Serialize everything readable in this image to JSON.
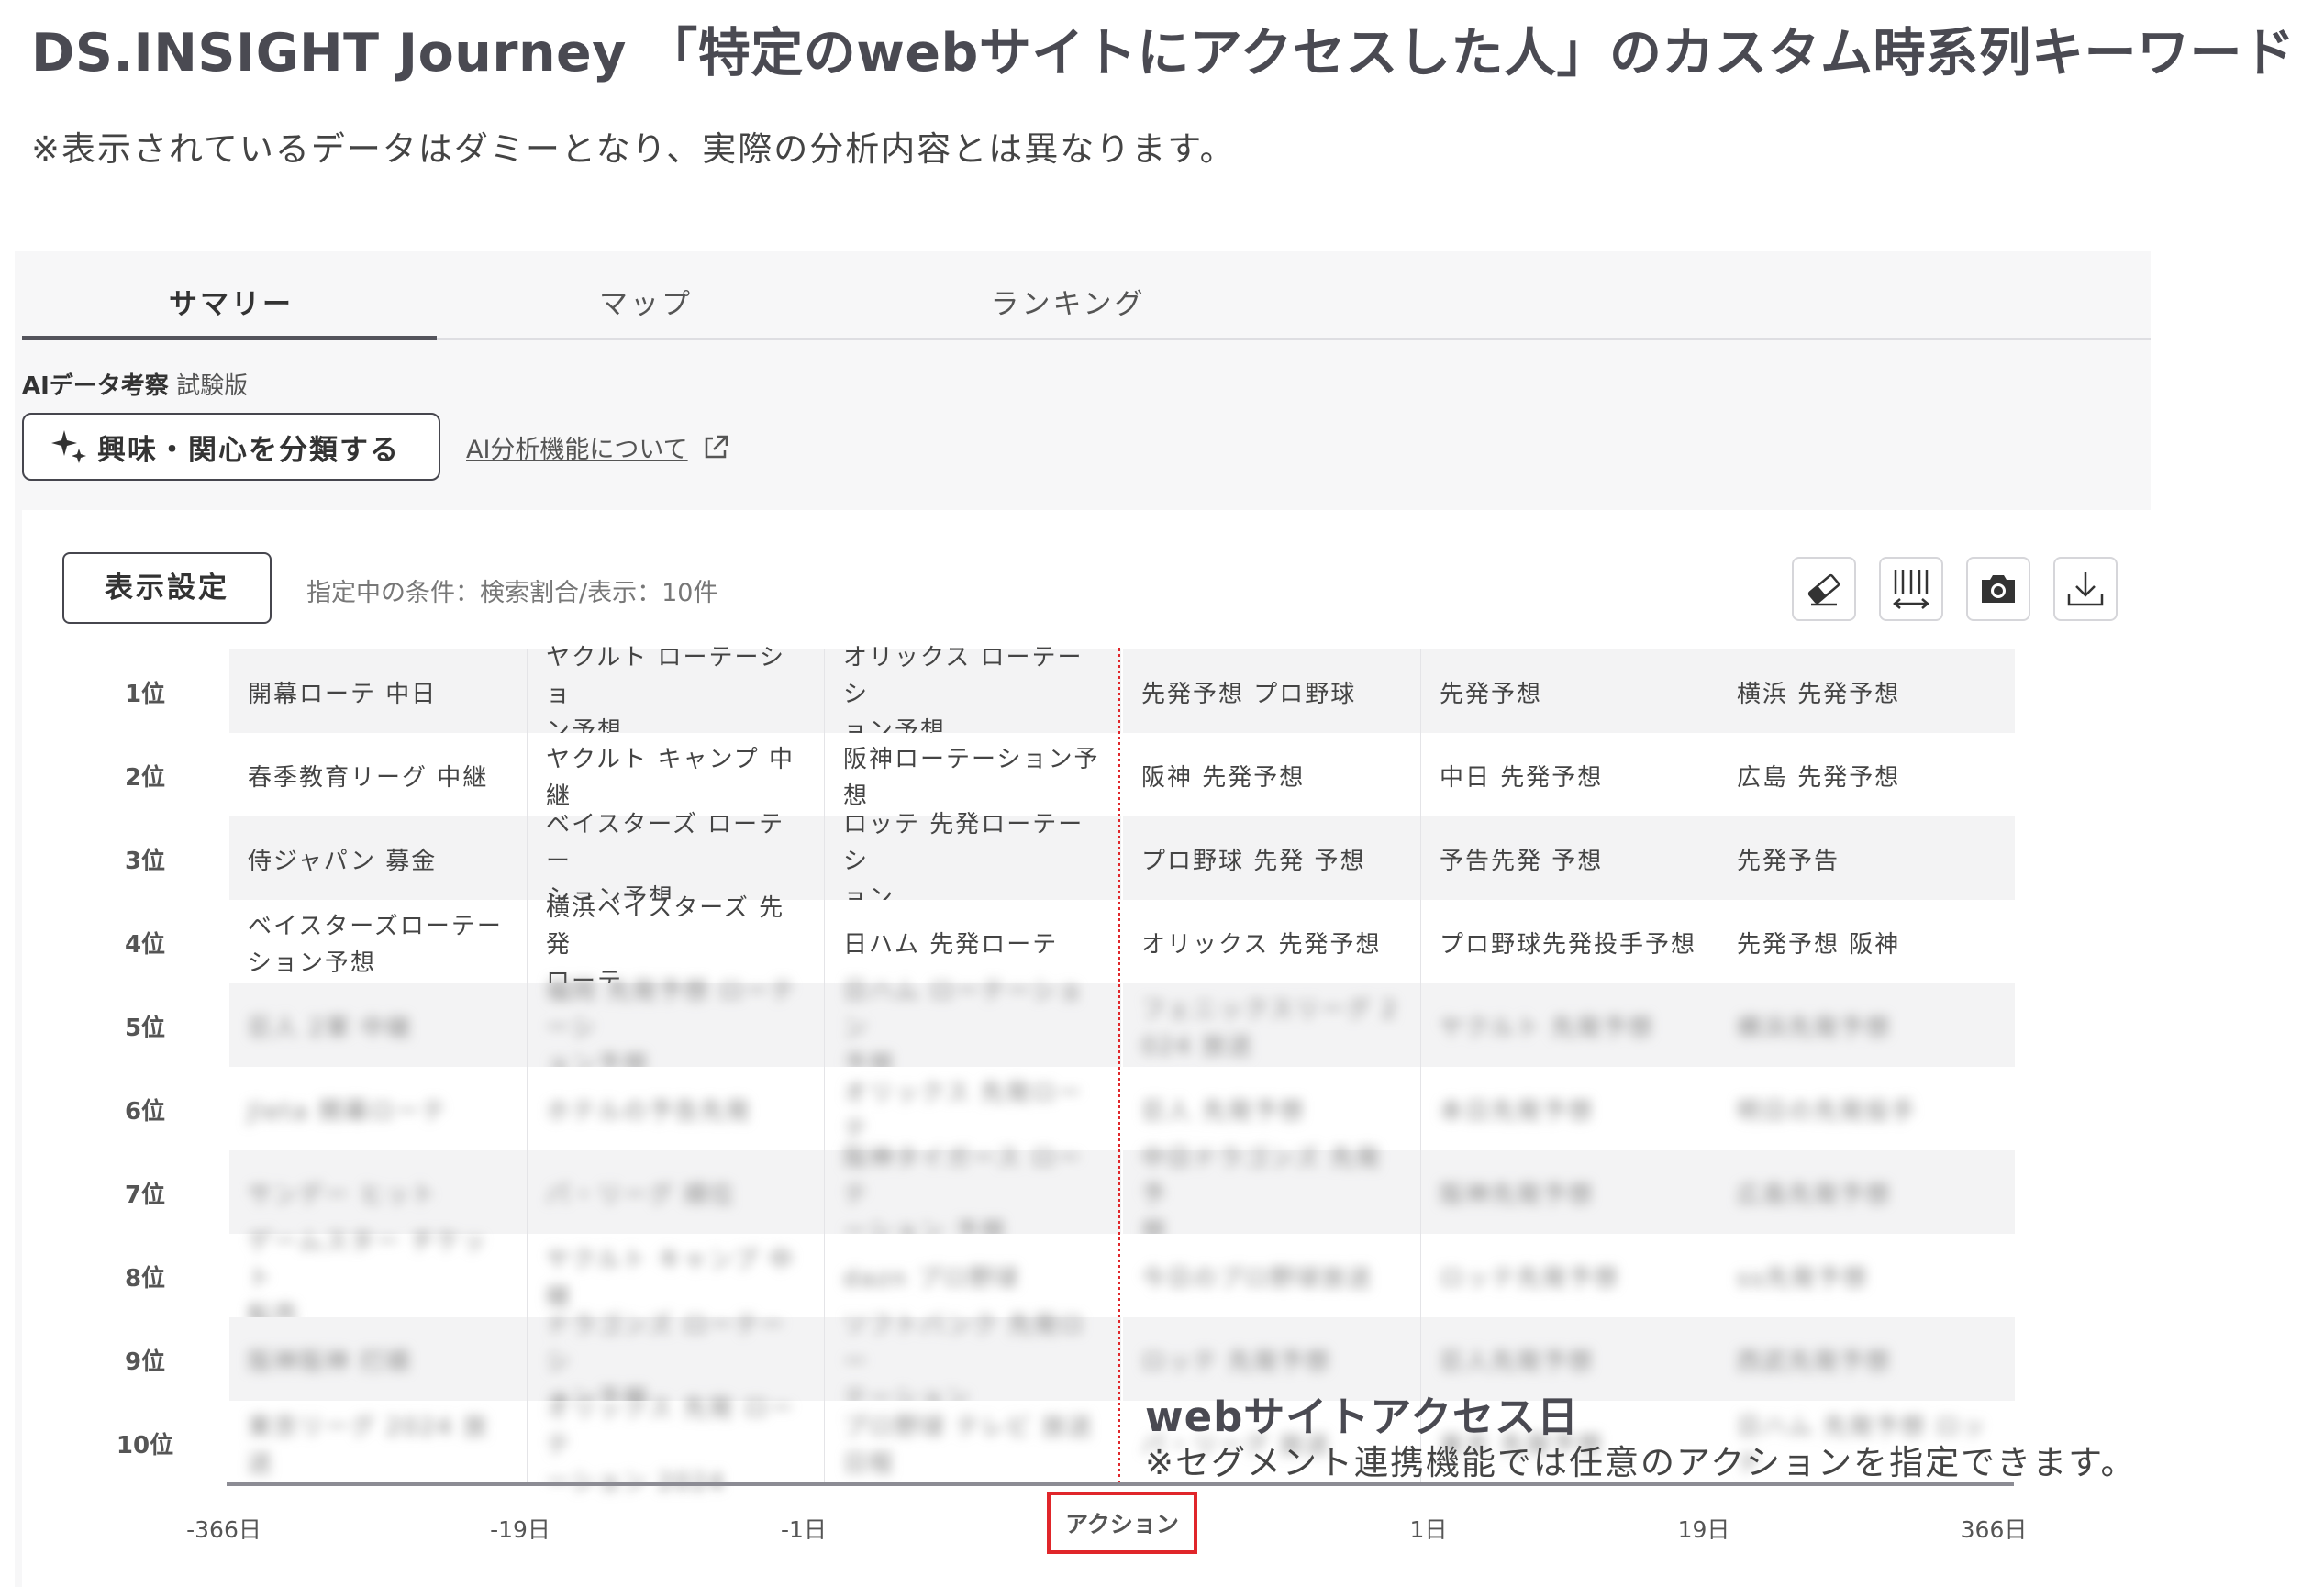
{
  "header": {
    "title": "DS.INSIGHT Journey 「特定のwebサイトにアクセスした人」のカスタム時系列キーワード",
    "note": "※表示されているデータはダミーとなり、実際の分析内容とは異なります。"
  },
  "tabs": [
    {
      "label": "サマリー",
      "active": true
    },
    {
      "label": "マップ",
      "active": false
    },
    {
      "label": "ランキング",
      "active": false
    }
  ],
  "ai": {
    "label": "AIデータ考察",
    "badge": "試験版",
    "classify_button": "興味・関心を分類する",
    "link": "AI分析機能について"
  },
  "toolbar": {
    "settings_button": "表示設定",
    "condition": "指定中の条件：検索割合/表示：10件",
    "icons": [
      "eraser-icon",
      "column-width-icon",
      "camera-icon",
      "download-icon"
    ]
  },
  "ranks": [
    "1位",
    "2位",
    "3位",
    "4位",
    "5位",
    "6位",
    "7位",
    "8位",
    "9位",
    "10位"
  ],
  "x_axis": [
    "-366日",
    "-19日",
    "-1日",
    "アクション",
    "1日",
    "19日",
    "366日"
  ],
  "columns": [
    {
      "period": "-366日",
      "cells": [
        [
          "開幕ローテ 中日"
        ],
        [
          "春季教育リーグ 中継"
        ],
        [
          "侍ジャパン 募金"
        ],
        [
          "ベイスターズローテー",
          "ション予想"
        ],
        [
          "巨人 2軍 中継"
        ],
        [
          "Jleta 開幕ローテ"
        ],
        [
          "サンデー ヒット"
        ],
        [
          "ゲームスター チケット",
          "転売"
        ],
        [
          "阪神阪神 打順"
        ],
        [
          "東京リーグ 2024 放送"
        ]
      ]
    },
    {
      "period": "-19日",
      "cells": [
        [
          "ヤクルト ローテーショ",
          "ン予想"
        ],
        [
          "ヤクルト キャンプ 中",
          "継"
        ],
        [
          "ベイスターズ ローテー",
          "ション予想"
        ],
        [
          "横浜ベイスターズ 先発",
          "ローテ"
        ],
        [
          "福岡 先発予想 ローテーシ",
          "ョン予想"
        ],
        [
          "ホテルの予告先発"
        ],
        [
          "パ・リーグ 順位"
        ],
        [
          "ヤクルト キャンプ 中継"
        ],
        [
          "ドラゴンズ ローテーシ",
          "ョン予想"
        ],
        [
          "オリックス 先発 ローテ",
          "ーション 2024"
        ]
      ]
    },
    {
      "period": "-1日",
      "cells": [
        [
          "オリックス ローテーシ",
          "ョン予想"
        ],
        [
          "阪神ローテーション予",
          "想"
        ],
        [
          "ロッテ 先発ローテーシ",
          "ョン"
        ],
        [
          "日ハム 先発ローテ"
        ],
        [
          "日ハム ローテーション",
          "予想"
        ],
        [
          "オリックス 先発ローテ"
        ],
        [
          "阪神タイガース ローテ",
          "ーション 予想"
        ],
        [
          "dazn プロ野球"
        ],
        [
          "ソフトバンク 先発ロー",
          "テーション"
        ],
        [
          "プロ野球 テレビ 放送",
          "日程"
        ]
      ]
    },
    {
      "period": "1日",
      "cells": [
        [
          "先発予想 プロ野球"
        ],
        [
          "阪神 先発予想"
        ],
        [
          "プロ野球 先発 予想"
        ],
        [
          "オリックス 先発予想"
        ],
        [
          "フェニックスリーグ 2",
          "024 放送"
        ],
        [
          "巨人 先発予想"
        ],
        [
          "中日ドラゴンズ 先発予",
          "想"
        ],
        [
          "今日のプロ野球放送"
        ],
        [
          "ロッテ 先発予想"
        ],
        [
          "パ・リーグ 放送"
        ]
      ]
    },
    {
      "period": "19日",
      "cells": [
        [
          "先発予想"
        ],
        [
          "中日 先発予想"
        ],
        [
          "予告先発 予想"
        ],
        [
          "プロ野球先発投手予想"
        ],
        [
          "ヤクルト 先発予想"
        ],
        [
          "本日先発予想"
        ],
        [
          "阪神先発予想"
        ],
        [
          "ロッテ先発予想"
        ],
        [
          "巨人先発予想"
        ],
        [
          "楽天 先発予想"
        ]
      ]
    },
    {
      "period": "366日",
      "cells": [
        [
          "横浜 先発予想"
        ],
        [
          "広島 先発予想"
        ],
        [
          "先発予告"
        ],
        [
          "先発予想 阪神"
        ],
        [
          "横浜先発予想"
        ],
        [
          "明日の先発投手"
        ],
        [
          "広島先発予想"
        ],
        [
          "ss先発予想"
        ],
        [
          "西武先発予想"
        ],
        [
          "日ハム 先発予想 ロッテ"
        ]
      ]
    }
  ],
  "annotation": {
    "title": "webサイトアクセス日",
    "subtitle": "※セグメント連携機能では任意のアクションを指定できます。"
  },
  "colors": {
    "action_marker": "#e0262a",
    "grid_stripe": "#f3f3f4",
    "text_dark": "#4a4a52"
  }
}
